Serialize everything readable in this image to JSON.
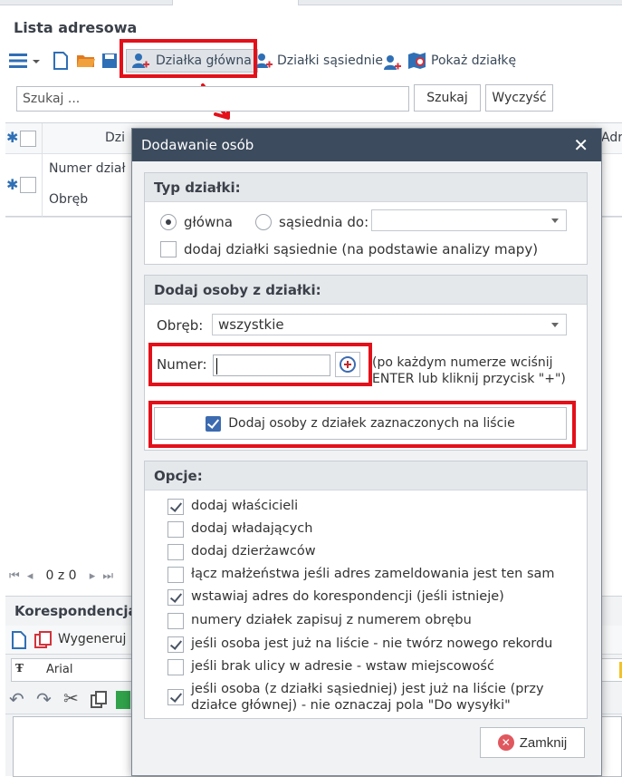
{
  "panel": {
    "title": "Lista adresowa"
  },
  "toolbar": {
    "dzialka_glowna": "Działka główna",
    "dzialki_sasiednie": "Działki sąsiednie",
    "pokaz_dzialke": "Pokaż działkę"
  },
  "search": {
    "placeholder": "Szukaj ...",
    "search_button": "Szukaj",
    "clear_button": "Wyczyść"
  },
  "grid": {
    "header_partial": "Dzi",
    "header_right_partial": "Adr",
    "row_numer": "Numer dział",
    "row_obreb": "Obręb"
  },
  "pager": {
    "text": "0 z 0"
  },
  "bottom_panel": {
    "title": "Korespondencja",
    "generate_label": "Wygeneruj p",
    "font_name": "Arial"
  },
  "dialog": {
    "title": "Dodawanie osób",
    "typ_dzialki": {
      "title": "Typ działki:",
      "radio_glowna": "główna",
      "radio_sasiednia": "sąsiednia do:",
      "sasiednia_value": "",
      "dodaj_sasiednie": "dodaj działki sąsiednie (na podstawie analizy mapy)"
    },
    "dodaj_osoby": {
      "title": "Dodaj osoby z działki:",
      "obreb_label": "Obręb:",
      "obreb_value": "wszystkie",
      "numer_label": "Numer:",
      "numer_value": "",
      "hint": "(po każdym numerze wciśnij ENTER lub kliknij przycisk \"+\")",
      "bulk_button": "Dodaj osoby z działek zaznaczonych na liście"
    },
    "opcje": {
      "title": "Opcje:",
      "items": [
        {
          "label": "dodaj właścicieli",
          "checked": true
        },
        {
          "label": "dodaj władających",
          "checked": false
        },
        {
          "label": "dodaj dzierżawców",
          "checked": false
        },
        {
          "label": "łącz małżeństwa jeśli adres zameldowania jest ten sam",
          "checked": false
        },
        {
          "label": "wstawiaj adres do korespondencji (jeśli istnieje)",
          "checked": true
        },
        {
          "label": "numery działek zapisuj z numerem obrębu",
          "checked": false
        },
        {
          "label": "jeśli osoba jest już na liście - nie twórz nowego rekordu",
          "checked": true
        },
        {
          "label": "jeśli brak ulicy w adresie - wstaw miejscowość",
          "checked": false
        },
        {
          "label": "jeśli osoba (z działki sąsiedniej) jest już na liście (przy działce głównej) - nie oznaczaj pola \"Do wysyłki\"",
          "checked": true
        }
      ]
    },
    "close_button": "Zamknij"
  },
  "colors": {
    "dialog_header": "#3c4b5d",
    "highlight": "#e3101a",
    "accent_blue": "#3c6bb0"
  }
}
